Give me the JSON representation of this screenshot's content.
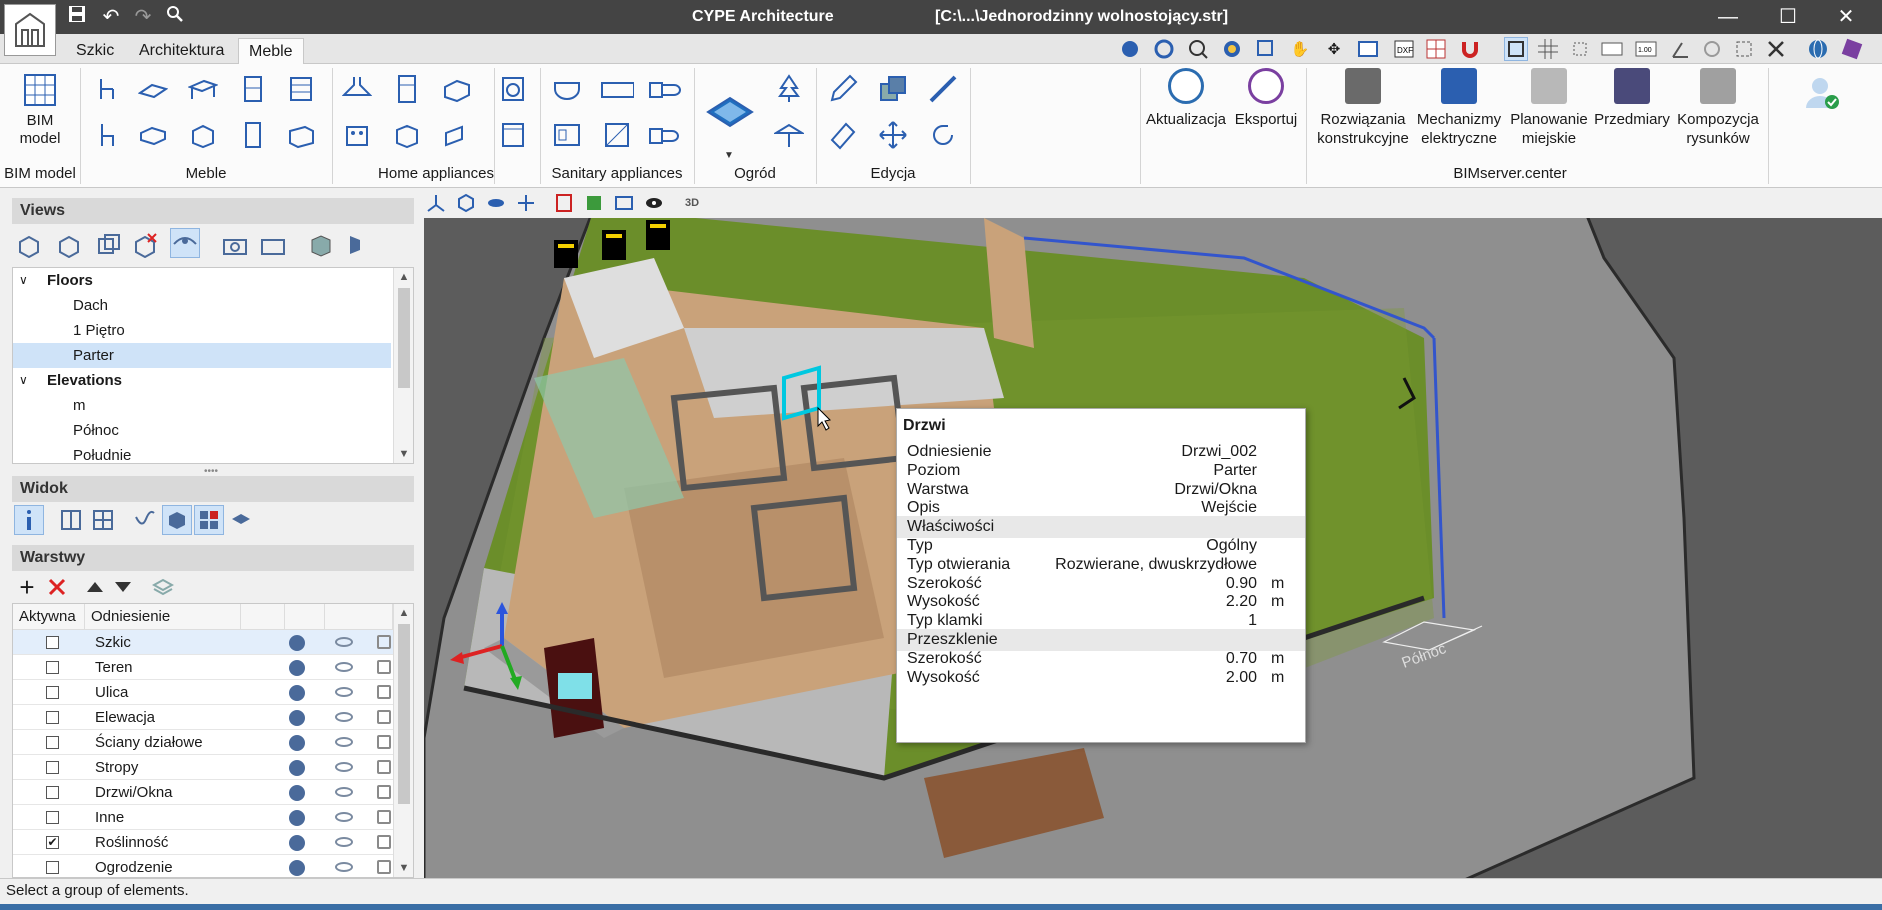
{
  "app": {
    "title": "CYPE Architecture",
    "file": "[C:\\...\\Jednorodzinny wolnostojący.str]"
  },
  "tabs": [
    {
      "label": "Szkic"
    },
    {
      "label": "Architektura"
    },
    {
      "label": "Meble",
      "active": true
    }
  ],
  "ribbon": {
    "bim_model_label": "BIM model",
    "groups": [
      {
        "label": "BIM model"
      },
      {
        "label": "Meble"
      },
      {
        "label": "Home appliances"
      },
      {
        "label": "Sanitary appliances"
      },
      {
        "label": "Ogród"
      },
      {
        "label": "Edycja"
      },
      {
        "label": "BIMserver.center"
      }
    ],
    "bimserver_buttons": [
      {
        "label": "Aktualizacja"
      },
      {
        "label": "Eksportuj"
      },
      {
        "label": "Rozwiązania konstrukcyjne"
      },
      {
        "label": "Mechanizmy elektryczne"
      },
      {
        "label": "Planowanie miejskie"
      },
      {
        "label": "Przedmiary"
      },
      {
        "label": "Kompozycja rysunków"
      }
    ]
  },
  "views": {
    "title": "Views",
    "tree": [
      {
        "label": "Floors",
        "type": "group"
      },
      {
        "label": "Dach",
        "type": "item"
      },
      {
        "label": "1 Piętro",
        "type": "item"
      },
      {
        "label": "Parter",
        "type": "item",
        "selected": true
      },
      {
        "label": "Elevations",
        "type": "group"
      },
      {
        "label": "m",
        "type": "item"
      },
      {
        "label": "Północ",
        "type": "item"
      },
      {
        "label": "Południe",
        "type": "item"
      }
    ]
  },
  "widok": {
    "title": "Widok"
  },
  "warstwy": {
    "title": "Warstwy",
    "columns": [
      "Aktywna",
      "Odniesienie"
    ],
    "rows": [
      {
        "name": "Szkic",
        "active": false,
        "selected": true
      },
      {
        "name": "Teren",
        "active": false
      },
      {
        "name": "Ulica",
        "active": false
      },
      {
        "name": "Elewacja",
        "active": false
      },
      {
        "name": "Ściany działowe",
        "active": false
      },
      {
        "name": "Stropy",
        "active": false
      },
      {
        "name": "Drzwi/Okna",
        "active": false
      },
      {
        "name": "Inne",
        "active": false
      },
      {
        "name": "Roślinność",
        "active": true
      },
      {
        "name": "Ogrodzenie",
        "active": false
      }
    ]
  },
  "tooltip": {
    "title": "Drzwi",
    "rows": [
      {
        "key": "Odniesienie",
        "value": "Drzwi_002"
      },
      {
        "key": "Poziom",
        "value": "Parter"
      },
      {
        "key": "Warstwa",
        "value": "Drzwi/Okna"
      },
      {
        "key": "Opis",
        "value": "Wejście"
      }
    ],
    "section1": "Właściwości",
    "props": [
      {
        "key": "Typ",
        "value": "Ogólny"
      },
      {
        "key": "Typ otwierania",
        "value": "Rozwierane, dwuskrzydłowe"
      },
      {
        "key": "Szerokość",
        "value": "0.90",
        "unit": "m"
      },
      {
        "key": "Wysokość",
        "value": "2.20",
        "unit": "m"
      },
      {
        "key": "Typ klamki",
        "value": "1"
      }
    ],
    "section2": "Przeszklenie",
    "glass": [
      {
        "key": "Szerokość",
        "value": "0.70",
        "unit": "m"
      },
      {
        "key": "Wysokość",
        "value": "2.00",
        "unit": "m"
      }
    ]
  },
  "viewport": {
    "north_label": "Północ",
    "toolbar_3d_label": "3D"
  },
  "status": "Select a group of elements.",
  "colors": {
    "titlebar": "#444444",
    "accent": "#2b6cb0",
    "grass": "#6b8e2a",
    "floor": "#c9a27a"
  }
}
